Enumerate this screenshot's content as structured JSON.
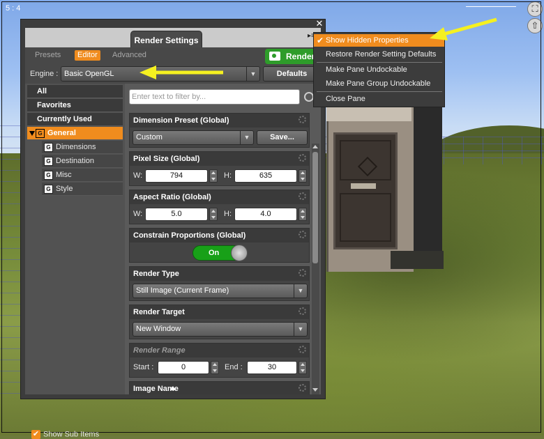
{
  "viewport": {
    "frame_label": "5 : 4"
  },
  "pane": {
    "title": "Render Settings",
    "tabs": [
      "Presets",
      "Editor",
      "Advanced"
    ],
    "render_button": "Render",
    "engine_label": "Engine :",
    "engine_value": "Basic OpenGL",
    "defaults_button": "Defaults"
  },
  "nav": {
    "items": [
      "All",
      "Favorites",
      "Currently Used",
      "General"
    ],
    "sub_items": [
      "Dimensions",
      "Destination",
      "Misc",
      "Style"
    ],
    "group_icon": "G",
    "show_sub_items": "Show Sub Items"
  },
  "editor": {
    "filter_placeholder": "Enter text to filter by...",
    "dimension_preset": {
      "title": "Dimension Preset (Global)",
      "value": "Custom",
      "save_button": "Save..."
    },
    "pixel_size": {
      "title": "Pixel Size (Global)",
      "w_label": "W:",
      "w_value": "794",
      "h_label": "H:",
      "h_value": "635"
    },
    "aspect_ratio": {
      "title": "Aspect Ratio (Global)",
      "w_label": "W:",
      "w_value": "5.0",
      "h_label": "H:",
      "h_value": "4.0"
    },
    "constrain": {
      "title": "Constrain Proportions (Global)",
      "toggle": "On"
    },
    "render_type": {
      "title": "Render Type",
      "value": "Still Image (Current Frame)"
    },
    "render_target": {
      "title": "Render Target",
      "value": "New Window"
    },
    "render_range": {
      "title": "Render Range",
      "start_label": "Start :",
      "start_value": "0",
      "end_label": "End :",
      "end_value": "30"
    },
    "image_name": {
      "title": "Image Name"
    }
  },
  "context_menu": {
    "items": [
      "Show Hidden Properties",
      "Restore Render Setting Defaults",
      "Make Pane Undockable",
      "Make Pane Group Undockable",
      "Close Pane"
    ],
    "checked": "Show Hidden Properties"
  },
  "colors": {
    "accent": "#f08c1e",
    "render_green": "#2e9c2a",
    "annotation_arrow": "#f5f020"
  }
}
